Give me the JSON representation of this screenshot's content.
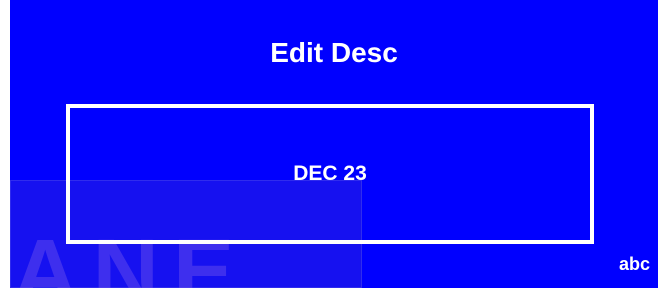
{
  "dialog": {
    "title": "Edit Desc",
    "field_value": "DEC 23",
    "input_mode": "abc"
  },
  "background": {
    "watermark_text": "ANE"
  },
  "colors": {
    "screen_background": "#0000ff",
    "text": "#ffffff",
    "field_border": "#ffffff",
    "margin_strip": "#ffffff"
  }
}
